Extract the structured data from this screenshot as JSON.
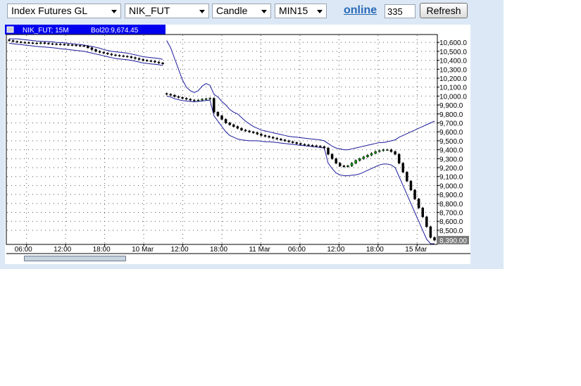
{
  "toolbar": {
    "market_select": "Index Futures GL",
    "symbol_select": "NIK_FUT",
    "chart_type_select": "Candle",
    "interval_select": "MIN15",
    "online_link": "online",
    "bars_count": "335",
    "refresh_label": "Refresh"
  },
  "chart": {
    "symbol_label": "NIK_FUT; 15M",
    "indicator_label": "Bol20:9,674.45",
    "colors": {
      "candle_up": "#00a000",
      "candle_down": "#000000",
      "bollinger": "#1a1a9a",
      "header_bar": "#0000ee",
      "grid": "#555555"
    }
  },
  "chart_data": {
    "type": "candlestick",
    "title": "NIK_FUT; 15M",
    "indicator": "Bol20:9,674.45",
    "ylim": [
      8350,
      10680
    ],
    "yticks": [
      "10,600.0",
      "10,500.0",
      "10,400.0",
      "10,300.0",
      "10,200.0",
      "10,100.0",
      "10,000.0",
      "9,900.0",
      "9,800.0",
      "9,700.0",
      "9,600.0",
      "9,500.0",
      "9,400.0",
      "9,300.0",
      "9,200.0",
      "9,100.0",
      "9,000.0",
      "8,900.0",
      "8,800.0",
      "8,700.0",
      "8,600.0",
      "8,500.0",
      "8,390.00"
    ],
    "last_price_label": "8,390.00",
    "xticks": [
      "06:00",
      "12:00",
      "18:00",
      "10 Mar",
      "12:00",
      "18:00",
      "11 Mar",
      "06:00",
      "12:00",
      "18:00",
      "15 Mar"
    ],
    "grid": true,
    "close_series": [
      10620,
      10610,
      10605,
      10600,
      10598,
      10595,
      10592,
      10590,
      10595,
      10590,
      10585,
      10582,
      10580,
      10578,
      10575,
      10572,
      10570,
      10565,
      10562,
      10560,
      10540,
      10520,
      10500,
      10490,
      10480,
      10470,
      10460,
      10455,
      10450,
      10445,
      10440,
      10430,
      10420,
      10410,
      10400,
      10395,
      10390,
      10380,
      10370,
      10360,
      10020,
      10010,
      9995,
      9985,
      9975,
      9965,
      9955,
      9950,
      9955,
      9965,
      9970,
      9975,
      9820,
      9780,
      9740,
      9700,
      9680,
      9660,
      9640,
      9620,
      9610,
      9600,
      9590,
      9575,
      9560,
      9550,
      9540,
      9530,
      9520,
      9510,
      9500,
      9490,
      9480,
      9470,
      9460,
      9455,
      9450,
      9445,
      9440,
      9435,
      9420,
      9350,
      9300,
      9250,
      9220,
      9210,
      9220,
      9250,
      9280,
      9300,
      9320,
      9340,
      9360,
      9380,
      9390,
      9400,
      9400,
      9380,
      9350,
      9250,
      9150,
      9050,
      8950,
      8850,
      8750,
      8650,
      8540,
      8420,
      8390
    ],
    "bollinger_upper": [
      10640,
      10640,
      10640,
      10635,
      10630,
      10625,
      10620,
      10615,
      10612,
      10610,
      10608,
      10605,
      10600,
      10598,
      10595,
      10590,
      10585,
      10580,
      10575,
      10570,
      10560,
      10555,
      10545,
      10535,
      10520,
      10510,
      10500,
      10495,
      10490,
      10485,
      10480,
      10470,
      10460,
      10450,
      10440,
      10435,
      10430,
      10425,
      10420,
      10410,
      10620,
      10540,
      10420,
      10300,
      10180,
      10100,
      10060,
      10040,
      10060,
      10110,
      10140,
      10120,
      10020,
      9990,
      9940,
      9900,
      9850,
      9820,
      9800,
      9760,
      9720,
      9690,
      9660,
      9640,
      9620,
      9610,
      9600,
      9590,
      9580,
      9570,
      9560,
      9550,
      9545,
      9540,
      9535,
      9530,
      9525,
      9520,
      9515,
      9510,
      9500,
      9470,
      9440,
      9420,
      9410,
      9400,
      9400,
      9410,
      9420,
      9430,
      9440,
      9450,
      9460,
      9470,
      9480,
      9480,
      9490,
      9500,
      9510,
      9540,
      9560,
      9580,
      9600,
      9620,
      9640,
      9660,
      9680,
      9700,
      9720
    ],
    "bollinger_lower": [
      10590,
      10585,
      10580,
      10575,
      10570,
      10565,
      10560,
      10555,
      10550,
      10548,
      10545,
      10540,
      10535,
      10530,
      10525,
      10520,
      10515,
      10510,
      10505,
      10500,
      10490,
      10480,
      10470,
      10460,
      10450,
      10440,
      10430,
      10420,
      10415,
      10410,
      10405,
      10400,
      10390,
      10380,
      10370,
      10365,
      10360,
      10355,
      10350,
      10340,
      10000,
      9990,
      9970,
      9960,
      9950,
      9945,
      9940,
      9935,
      9940,
      9945,
      9950,
      9955,
      9780,
      9720,
      9660,
      9600,
      9560,
      9540,
      9520,
      9510,
      9505,
      9500,
      9500,
      9500,
      9495,
      9490,
      9490,
      9485,
      9480,
      9475,
      9470,
      9465,
      9460,
      9455,
      9450,
      9445,
      9440,
      9435,
      9430,
      9425,
      9420,
      9250,
      9190,
      9140,
      9120,
      9110,
      9110,
      9115,
      9120,
      9130,
      9150,
      9170,
      9190,
      9210,
      9230,
      9240,
      9240,
      9230,
      9200,
      9100,
      9000,
      8900,
      8800,
      8700,
      8600,
      8500,
      8400,
      8350,
      8350
    ]
  },
  "scrollbar": {
    "visible_fraction": 0.22
  }
}
